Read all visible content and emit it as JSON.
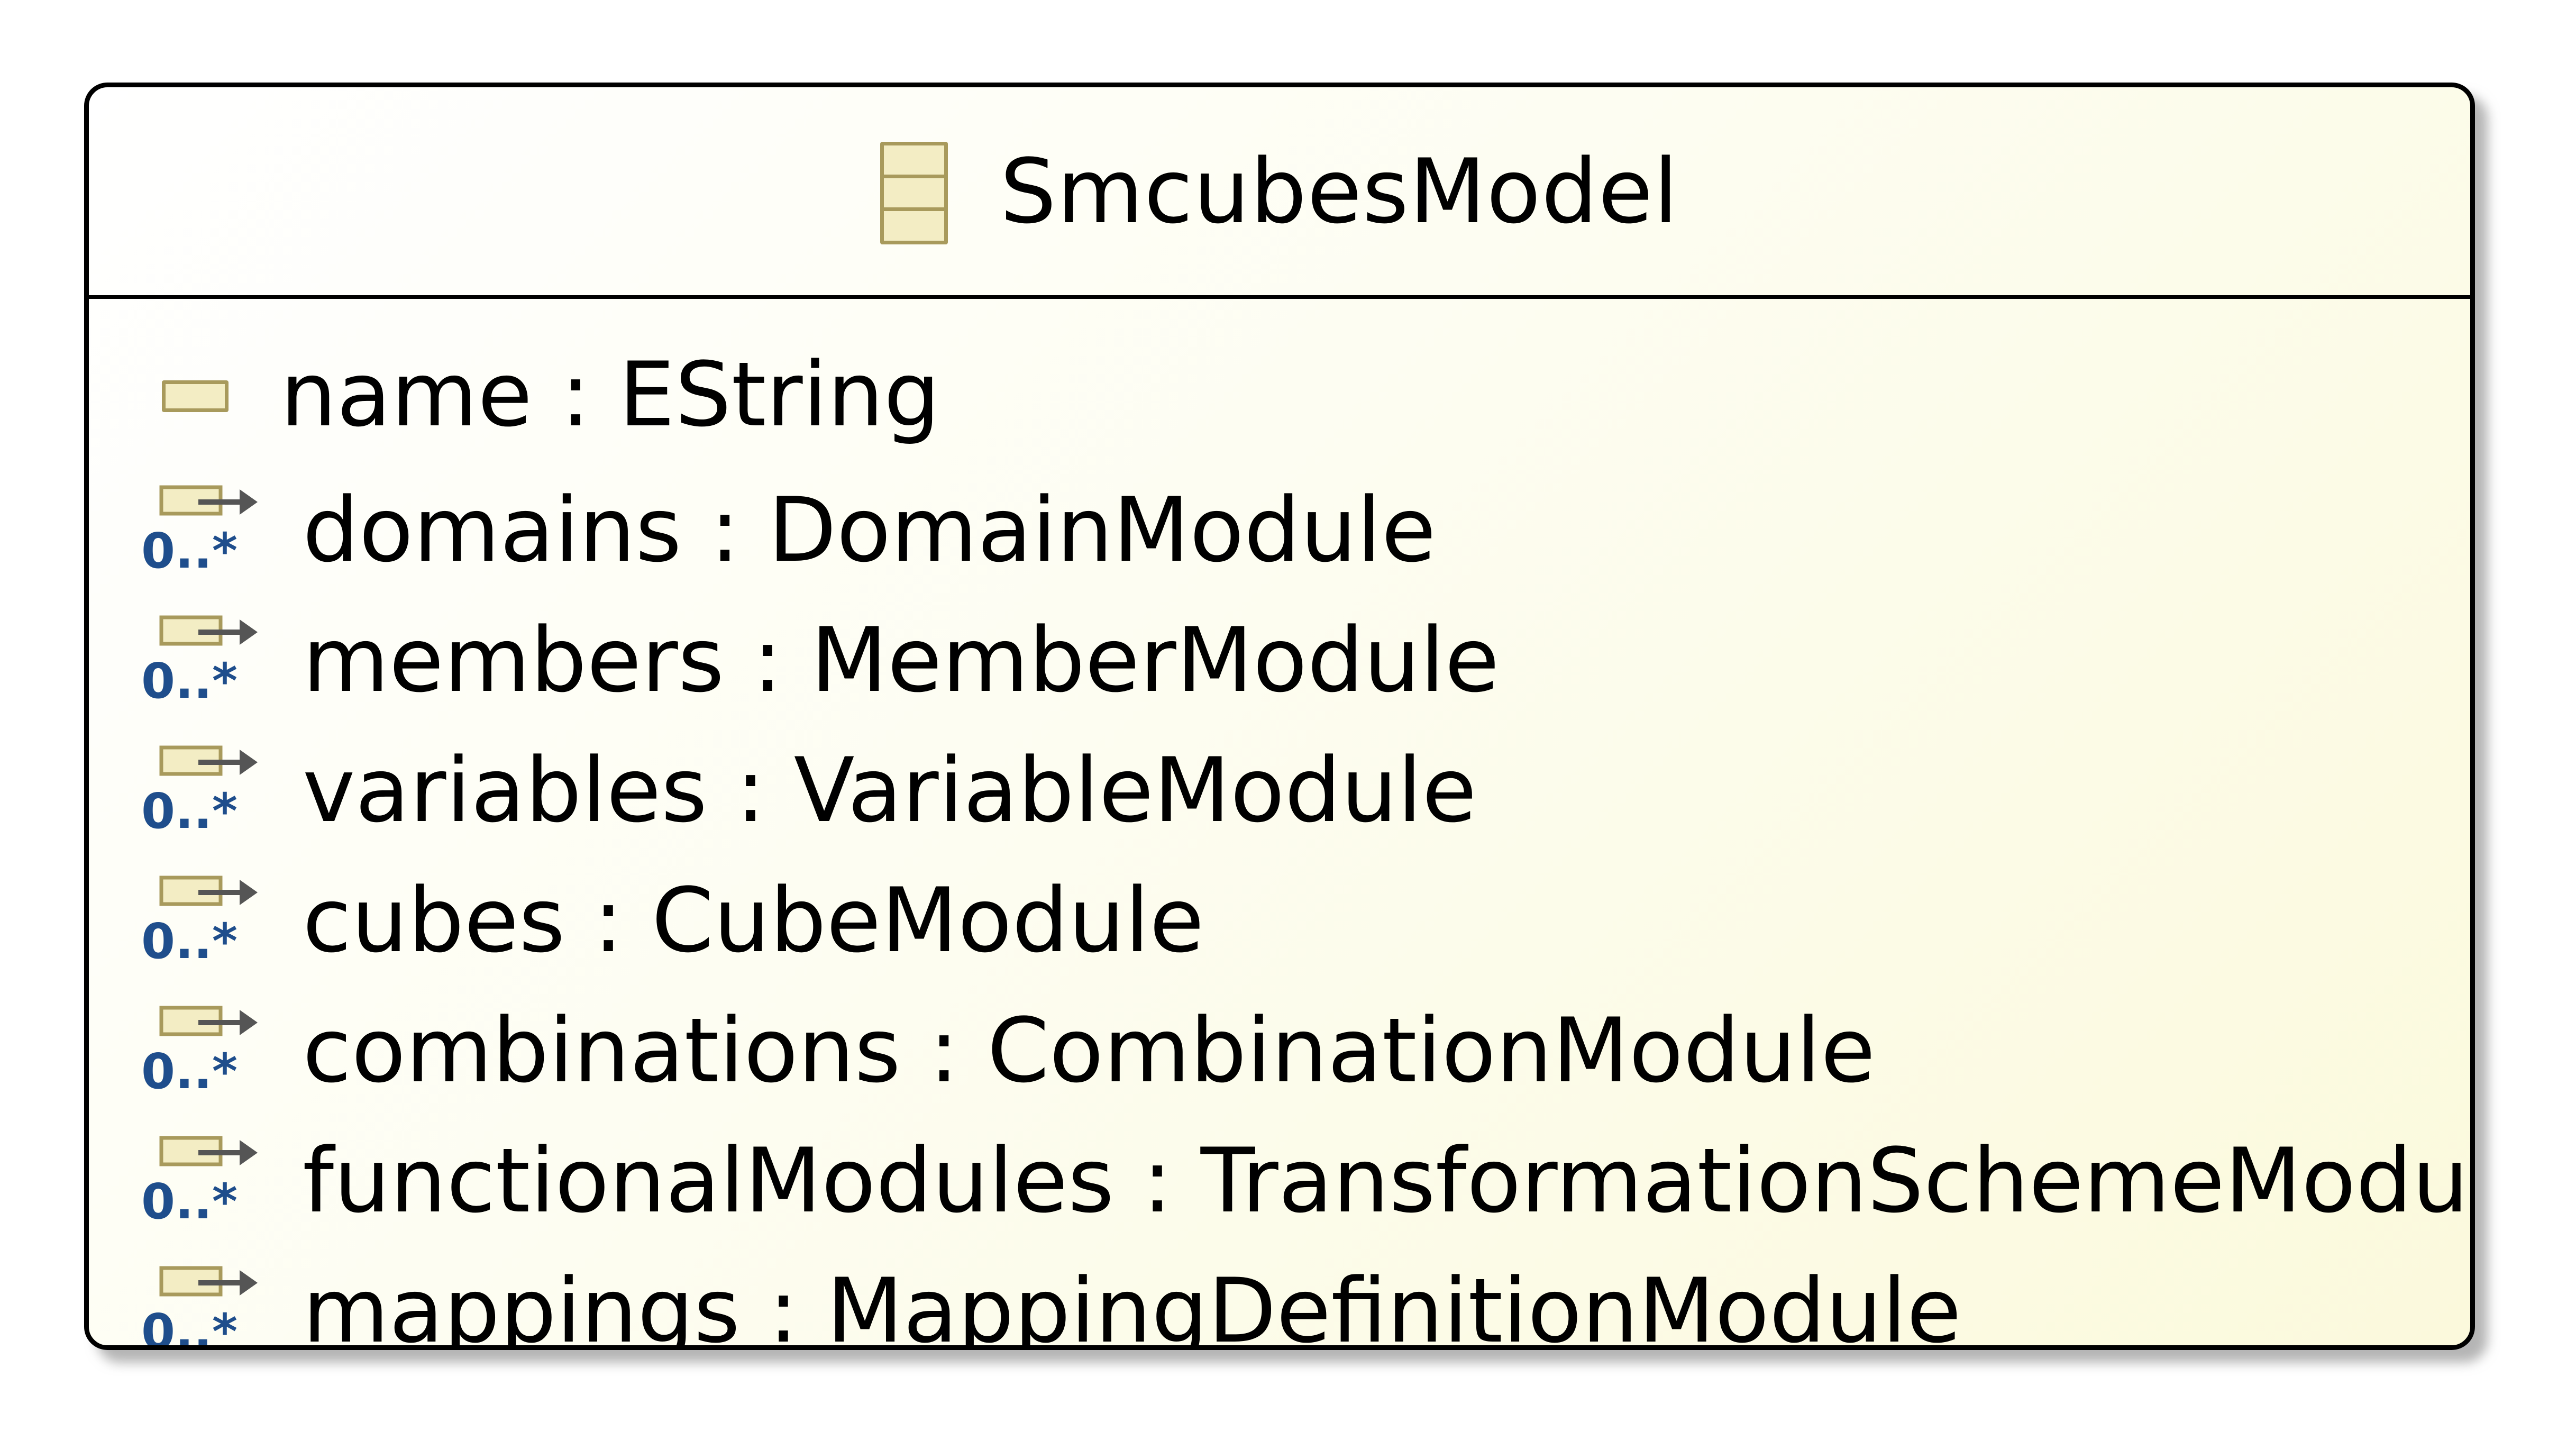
{
  "class": {
    "name": "SmcubesModel",
    "icon": "eclass-icon"
  },
  "attributes": [
    {
      "label": "name : EString",
      "icon": "eattribute-icon"
    }
  ],
  "references": [
    {
      "label": "domains : DomainModule",
      "multiplicity": "0..*",
      "icon": "ereference-containment-icon"
    },
    {
      "label": "members : MemberModule",
      "multiplicity": "0..*",
      "icon": "ereference-containment-icon"
    },
    {
      "label": "variables : VariableModule",
      "multiplicity": "0..*",
      "icon": "ereference-containment-icon"
    },
    {
      "label": "cubes : CubeModule",
      "multiplicity": "0..*",
      "icon": "ereference-containment-icon"
    },
    {
      "label": "combinations : CombinationModule",
      "multiplicity": "0..*",
      "icon": "ereference-containment-icon"
    },
    {
      "label": "functionalModules : TransformationSchemeModule",
      "multiplicity": "0..*",
      "icon": "ereference-containment-icon"
    },
    {
      "label": "mappings : MappingDefinitionModule",
      "multiplicity": "0..*",
      "icon": "ereference-containment-icon"
    }
  ],
  "colors": {
    "border": "#000000",
    "fill_start": "#ffffff",
    "fill_end": "#fbf9dc",
    "icon_stroke": "#a89a5c",
    "icon_fill": "#f3edc4",
    "multiplicity_blue": "#1f4e8c"
  }
}
